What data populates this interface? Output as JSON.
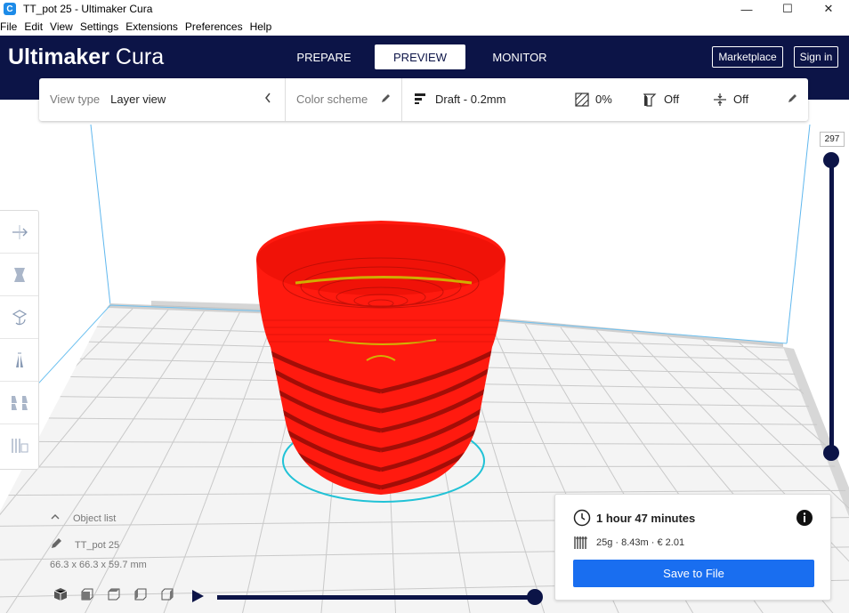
{
  "window": {
    "title": "TT_pot 25 - Ultimaker Cura",
    "app_icon_letter": "C",
    "minimize": "—",
    "maximize": "☐",
    "close": "✕"
  },
  "menu": [
    "File",
    "Edit",
    "View",
    "Settings",
    "Extensions",
    "Preferences",
    "Help"
  ],
  "header": {
    "brand": "Ultimaker",
    "product": "Cura",
    "stages": [
      "PREPARE",
      "PREVIEW",
      "MONITOR"
    ],
    "active_stage": "PREVIEW",
    "marketplace_label": "Marketplace",
    "signin_label": "Sign in"
  },
  "toolbar": {
    "view_type_label": "View type",
    "view_type_value": "Layer view",
    "color_scheme_label": "Color scheme",
    "profile": "Draft - 0.2mm",
    "infill": "0%",
    "support": "Off",
    "adhesion": "Off"
  },
  "layers": {
    "current_layer": "297"
  },
  "object": {
    "list_label": "Object list",
    "name": "TT_pot 25",
    "dimensions": "66.3 x 66.3 x 59.7 mm"
  },
  "print": {
    "time": "1 hour 47 minutes",
    "material": "25g · 8.43m · € 2.01",
    "save_label": "Save to File"
  },
  "colors": {
    "header_bg": "#0c1447",
    "accent_blue": "#196ef0",
    "model_red": "#ff1a1a",
    "build_outline": "#21c2d6"
  },
  "icons": {
    "clock": "clock-icon",
    "info": "info-icon",
    "spool": "spool-icon",
    "pencil": "pencil-icon",
    "chevron": "chevron-left-icon"
  }
}
